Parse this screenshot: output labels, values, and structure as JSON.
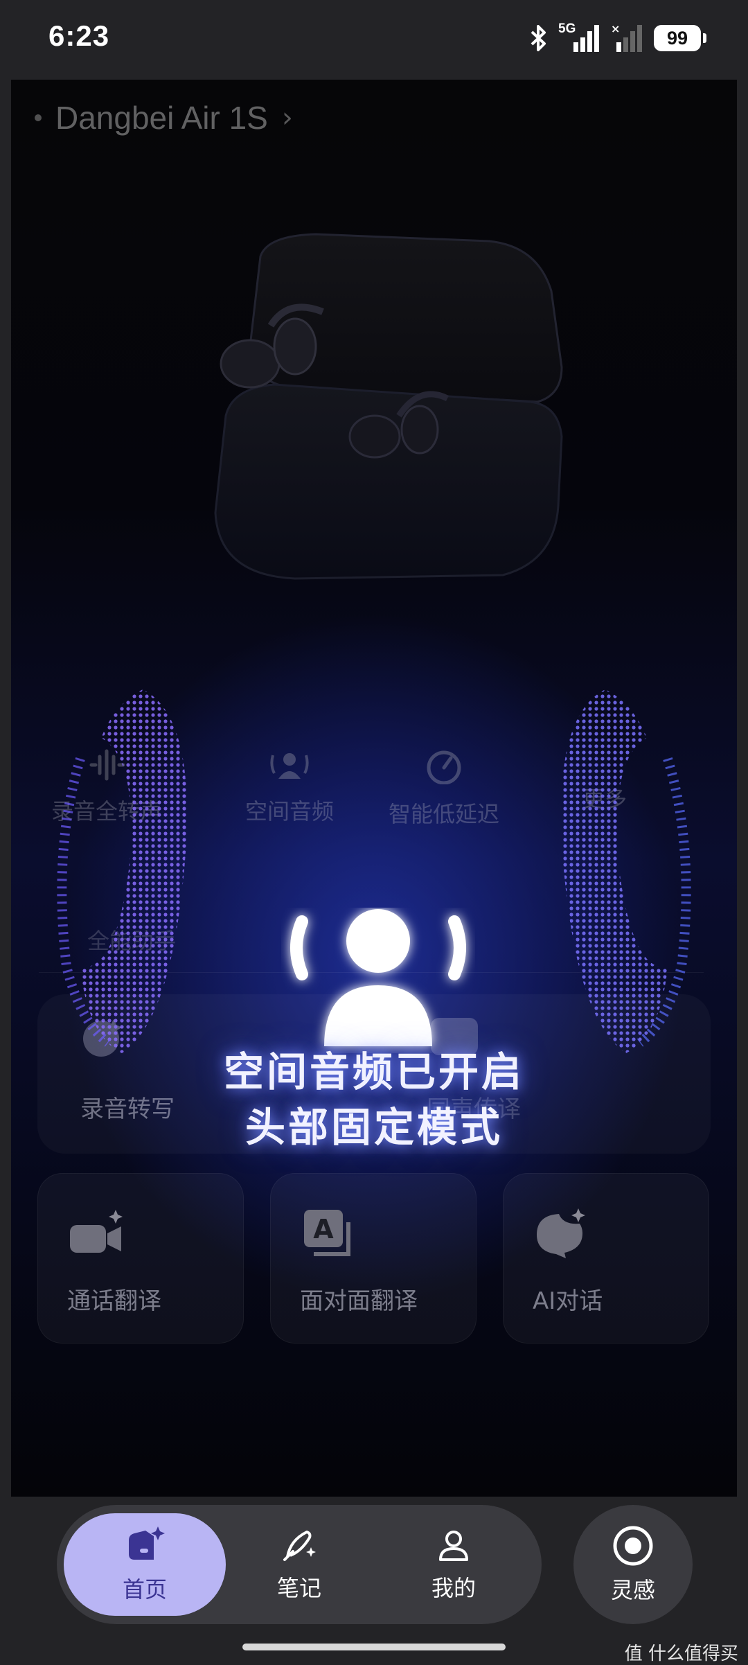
{
  "status_bar": {
    "time": "6:23",
    "network": "5G",
    "battery": "99"
  },
  "device": {
    "name": "Dangbei Air 1S"
  },
  "features_row": [
    {
      "label": "录音全转声",
      "icon": "waveform-icon"
    },
    {
      "label": "空间音频",
      "icon": "spatial-audio-icon"
    },
    {
      "label": "智能低延迟",
      "icon": "gauge-icon"
    },
    {
      "label": "更多",
      "icon": "more-icon"
    }
  ],
  "assistant_label": "全能助手",
  "overlay": {
    "line1": "空间音频已开启",
    "line2": "头部固定模式",
    "icon": "spatial-audio-head-icon"
  },
  "mid_cards": [
    {
      "label": "录音转写",
      "icon": "record-transcribe-icon"
    },
    {
      "label": "同声传译",
      "icon": "interpret-icon"
    }
  ],
  "cards": [
    {
      "label": "通话翻译",
      "icon": "video-call-sparkle-icon"
    },
    {
      "label": "面对面翻译",
      "icon": "translate-a-icon"
    },
    {
      "label": "AI对话",
      "icon": "ai-chat-icon"
    }
  ],
  "nav": {
    "items": [
      {
        "label": "首页",
        "icon": "home-icon",
        "active": true
      },
      {
        "label": "笔记",
        "icon": "pen-icon",
        "active": false
      },
      {
        "label": "我的",
        "icon": "profile-icon",
        "active": false
      }
    ],
    "inspiration": {
      "label": "灵感",
      "icon": "record-circle-icon"
    }
  },
  "watermark": "值 什么值得买",
  "colors": {
    "accent": "#b9b5f4",
    "glow": "#3b4cff",
    "wave": "#7a66ff"
  }
}
